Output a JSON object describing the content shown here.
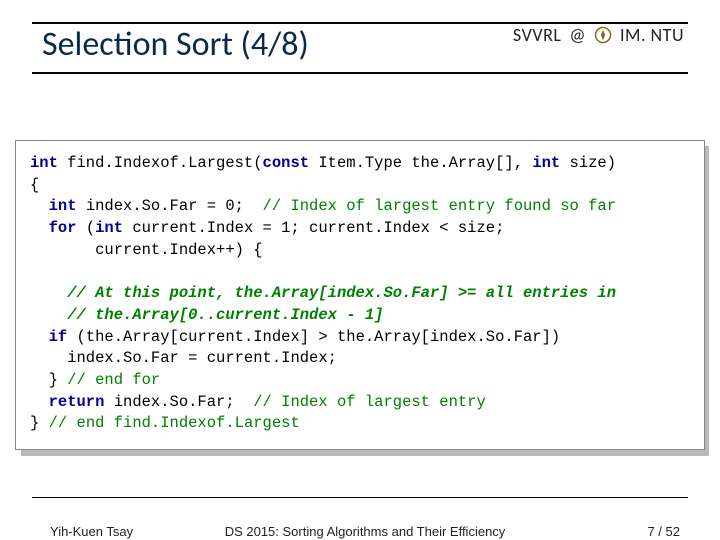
{
  "header": {
    "title": "Selection Sort (4/8)",
    "affil_left": "SVVRL",
    "affil_right": "IM. NTU"
  },
  "code": {
    "l1_a": "int",
    "l1_b": " find.Indexof.Largest(",
    "l1_c": "const",
    "l1_d": " Item.Type the.Array[], ",
    "l1_e": "int",
    "l1_f": " size)",
    "l2": "{",
    "l3_a": "  int",
    "l3_b": " index.So.Far = 0;  ",
    "l3_c": "// Index of largest entry found so far",
    "l4_a": "  for",
    "l4_b": " (",
    "l4_c": "int",
    "l4_d": " current.Index = 1; current.Index < size;",
    "l5": "       current.Index++) {",
    "blank1": "",
    "l6": "    // At this point, the.Array[index.So.Far] >= all entries in",
    "l7": "    // the.Array[0..current.Index - 1]",
    "l8_a": "  if",
    "l8_b": " (the.Array[current.Index] > the.Array[index.So.Far])",
    "l9": "    index.So.Far = current.Index;",
    "l10_a": "  } ",
    "l10_b": "// end for",
    "l11_a": "  return",
    "l11_b": " index.So.Far;  ",
    "l11_c": "// Index of largest entry",
    "l12_a": "} ",
    "l12_b": "// end find.Indexof.Largest"
  },
  "footer": {
    "left": "Yih-Kuen Tsay",
    "center": "DS 2015: Sorting Algorithms and Their Efficiency",
    "right_cur": "7",
    "right_sep": " / ",
    "right_tot": "52"
  }
}
